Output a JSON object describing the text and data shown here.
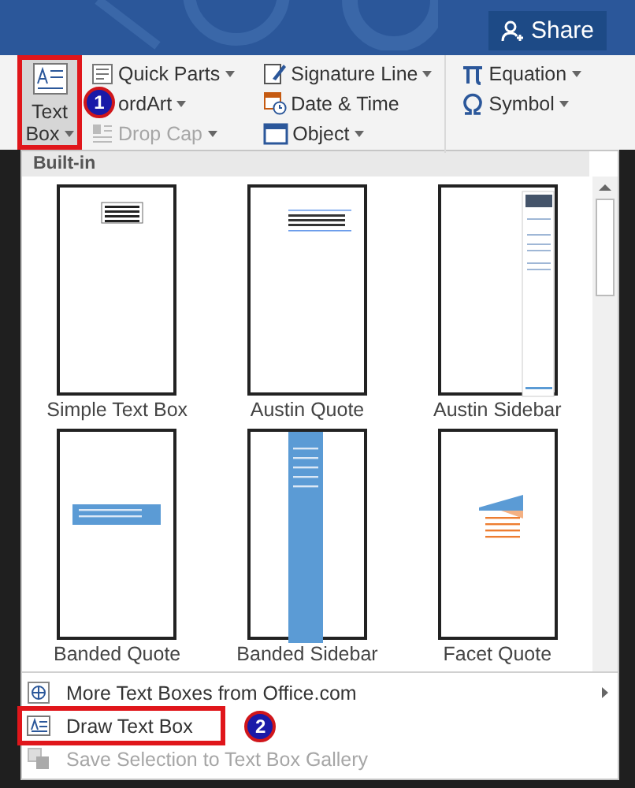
{
  "header": {
    "share": "Share"
  },
  "ribbon": {
    "text_box": {
      "line_1": "Text",
      "line_2": "Box",
      "highlighted": true,
      "callout": "1"
    },
    "columns": [
      [
        {
          "label": "Quick Parts",
          "dropdown": true,
          "disabled": false
        },
        {
          "label": "ordArt",
          "dropdown": true,
          "disabled": false
        },
        {
          "label": "Drop Cap",
          "dropdown": true,
          "disabled": true
        }
      ],
      [
        {
          "label": "Signature Line",
          "dropdown": true,
          "disabled": false
        },
        {
          "label": "Date & Time",
          "dropdown": false,
          "disabled": false
        },
        {
          "label": "Object",
          "dropdown": true,
          "disabled": false
        }
      ],
      [
        {
          "label": "Equation",
          "dropdown": true,
          "disabled": false
        },
        {
          "label": "Symbol",
          "dropdown": true,
          "disabled": false
        }
      ]
    ]
  },
  "gallery": {
    "heading": "Built-in",
    "items": [
      {
        "label": "Simple Text Box",
        "kind": "simple"
      },
      {
        "label": "Austin Quote",
        "kind": "quote"
      },
      {
        "label": "Austin Sidebar",
        "kind": "sidebar"
      },
      {
        "label": "Banded Quote",
        "kind": "banded_quote"
      },
      {
        "label": "Banded Sidebar",
        "kind": "banded_sidebar"
      },
      {
        "label": "Facet Quote",
        "kind": "facet"
      }
    ]
  },
  "menu": [
    {
      "label": "More Text Boxes from Office.com",
      "submenu": true,
      "disabled": false,
      "highlighted": false
    },
    {
      "label": "Draw Text Box",
      "submenu": false,
      "disabled": false,
      "highlighted": true,
      "callout": "2"
    },
    {
      "label": "Save Selection to Text Box Gallery",
      "submenu": false,
      "disabled": true,
      "highlighted": false
    }
  ]
}
